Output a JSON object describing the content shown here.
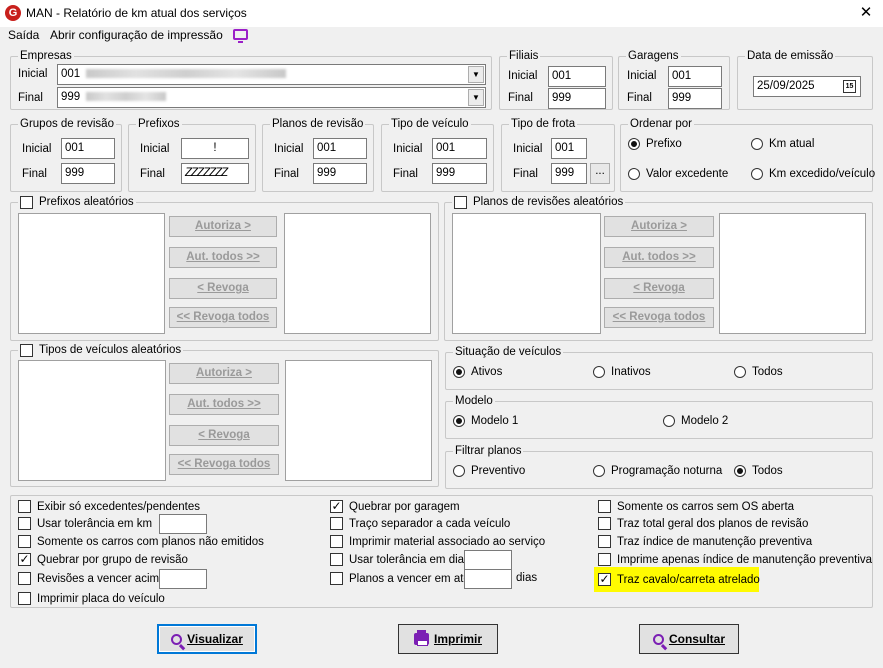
{
  "window": {
    "title": "MAN - Relatório de km atual dos serviços",
    "logo": "G",
    "close": "✕"
  },
  "menu": {
    "items": [
      "Saída",
      "Abrir configuração de impressão"
    ],
    "icon": "monitor-icon"
  },
  "empresas": {
    "label": "Empresas",
    "inicial_label": "Inicial",
    "final_label": "Final",
    "inicial_value": "001",
    "final_value": "999"
  },
  "filiais": {
    "label": "Filiais",
    "inicial_label": "Inicial",
    "final_label": "Final",
    "inicial_value": "001",
    "final_value": "999"
  },
  "garagens": {
    "label": "Garagens",
    "inicial_label": "Inicial",
    "final_label": "Final",
    "inicial_value": "001",
    "final_value": "999"
  },
  "data_emissao": {
    "label": "Data de emissão",
    "value": "25/09/2025",
    "calendar_glyph": "15"
  },
  "grupos_revisao": {
    "label": "Grupos de revisão",
    "inicial_label": "Inicial",
    "final_label": "Final",
    "inicial_value": "001",
    "final_value": "999"
  },
  "prefixos": {
    "label": "Prefixos",
    "inicial_label": "Inicial",
    "final_label": "Final",
    "inicial_value": "!",
    "final_value": "ZZZZZZZ"
  },
  "planos_revisao": {
    "label": "Planos de revisão",
    "inicial_label": "Inicial",
    "final_label": "Final",
    "inicial_value": "001",
    "final_value": "999"
  },
  "tipo_veiculo": {
    "label": "Tipo de veículo",
    "inicial_label": "Inicial",
    "final_label": "Final",
    "inicial_value": "001",
    "final_value": "999"
  },
  "tipo_frota": {
    "label": "Tipo de frota",
    "inicial_label": "Inicial",
    "final_label": "Final",
    "inicial_value": "001",
    "final_value": "999",
    "ellipsis": "..."
  },
  "ordenar_por": {
    "label": "Ordenar por",
    "options": [
      "Prefixo",
      "Km atual",
      "Valor excedente",
      "Km excedido/veículo"
    ],
    "selected": "Prefixo"
  },
  "transfer_buttons": {
    "autoriza": "Autoriza >",
    "aut_todos": "Aut. todos >>",
    "revoga": "< Revoga",
    "revoga_todos": "<< Revoga todos"
  },
  "prefixos_aleatorios": {
    "label": "Prefixos aleatórios",
    "checked": false
  },
  "planos_aleatorios": {
    "label": "Planos de revisões aleatórios",
    "checked": false
  },
  "tipos_aleatorios": {
    "label": "Tipos de veículos aleatórios",
    "checked": false
  },
  "situacao": {
    "label": "Situação de veículos",
    "options": [
      "Ativos",
      "Inativos",
      "Todos"
    ],
    "selected": "Ativos"
  },
  "modelo": {
    "label": "Modelo",
    "options": [
      "Modelo 1",
      "Modelo 2"
    ],
    "selected": "Modelo 1"
  },
  "filtrar_planos": {
    "label": "Filtrar planos",
    "options": [
      "Preventivo",
      "Programação noturna",
      "Todos"
    ],
    "selected": "Todos"
  },
  "options_col1": [
    {
      "label": "Exibir só excedentes/pendentes",
      "checked": false
    },
    {
      "label": "Usar tolerância em km",
      "checked": false
    },
    {
      "label": "Somente os carros com planos não emitidos",
      "checked": false
    },
    {
      "label": "Quebrar por grupo de revisão",
      "checked": true
    },
    {
      "label": "Revisões a vencer acima",
      "checked": false
    },
    {
      "label": "Imprimir placa do veículo",
      "checked": false
    }
  ],
  "options_col2": [
    {
      "label": "Quebrar por garagem",
      "checked": true
    },
    {
      "label": "Traço separador a cada veículo",
      "checked": false
    },
    {
      "label": "Imprimir material associado ao serviço",
      "checked": false
    },
    {
      "label": "Usar tolerância em dias",
      "checked": false
    },
    {
      "label": "Planos a vencer em até",
      "checked": false,
      "suffix": "dias"
    }
  ],
  "options_col3": [
    {
      "label": "Somente os carros sem OS aberta",
      "checked": false
    },
    {
      "label": "Traz total geral dos planos de revisão",
      "checked": false
    },
    {
      "label": "Traz índice de manutenção preventiva",
      "checked": false
    },
    {
      "label": "Imprime apenas índice de manutenção preventiva",
      "checked": false
    },
    {
      "label": "Traz cavalo/carreta atrelado",
      "checked": true,
      "highlight_color": "#fffb00"
    }
  ],
  "actions": {
    "visualizar": "Visualizar",
    "imprimir": "Imprimir",
    "consultar": "Consultar"
  },
  "colors": {
    "accent": "#0078d7",
    "icon_purple": "#7b1fb4",
    "logo_red": "#c8201c",
    "highlight": "#fffb00"
  }
}
